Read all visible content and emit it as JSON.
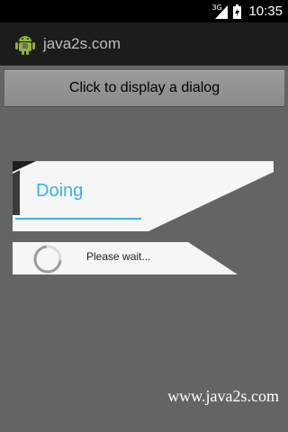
{
  "status_bar": {
    "network_label": "3G",
    "time": "10:35"
  },
  "title_bar": {
    "app_icon": "android-icon",
    "title": "java2s.com"
  },
  "main": {
    "show_dialog_button_label": "Click to display a dialog"
  },
  "progress_dialog": {
    "title": "Doing",
    "message": "Please wait...",
    "spinner_icon": "spinner-icon",
    "accent_color": "#33b5e5"
  },
  "watermark": "www.java2s.com",
  "colors": {
    "background": "#636563",
    "title_bar": "#1b1c1b",
    "button": "#929492",
    "dialog": "#f6f6f6"
  }
}
